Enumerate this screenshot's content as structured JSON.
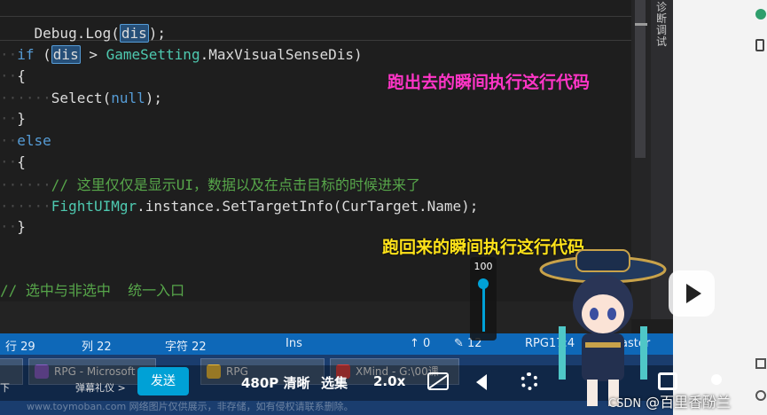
{
  "editor": {
    "lines": {
      "l1": {
        "text1": "Debug.Log(",
        "hl": "dis",
        "text2": ");"
      },
      "l2": {
        "kw": "if",
        "open": " (",
        "hl": "dis",
        "op": " > ",
        "type": "GameSetting",
        "rest": ".MaxVisualSenseDis)"
      },
      "l3": "{",
      "l4": {
        "call": "Select(",
        "kw": "null",
        "rest": ");"
      },
      "l5": "}",
      "l6": "else",
      "l7": "{",
      "l8": "// 这里仅仅是显示UI，数据以及在点击目标的时候进来了",
      "l9": {
        "type": "FightUIMgr",
        "rest": ".instance.SetTargetInfo(CurTarget.Name);"
      },
      "l10": "}",
      "l11": "// 选中与非选中  统一入口"
    }
  },
  "annotations": {
    "run_out": "跑出去的瞬间执行这行代码",
    "run_back": "跑回来的瞬间执行这行代码"
  },
  "right_panel": {
    "label1": "诊",
    "label2": "断",
    "label3": "调",
    "label4": "试"
  },
  "statusbar": {
    "row": "行 29",
    "col": "列 22",
    "char": "字符 22",
    "ins": "Ins",
    "up": "↑ 0",
    "edit": "✎ 12",
    "project": "RPG17:4",
    "master": "aster"
  },
  "taskbar": {
    "items": [
      {
        "label": "RPG - Microsoft"
      },
      {
        "label": "RPG"
      },
      {
        "label": "XMind - G:\\00课"
      }
    ],
    "left_text": "下"
  },
  "player": {
    "danmu": "弹幕礼仪 >",
    "send": "发送",
    "quality": "480P 清晰",
    "episodes": "选集",
    "speed": "2.0x",
    "volume": 100
  },
  "overlay": {
    "csdn_prefix": "CSDN",
    "csdn_name": "@百里香酚兰",
    "watermark": "www.toymoban.com 网络图片仅供展示，非存储，如有侵权请联系删除。"
  },
  "colors": {
    "keyword": "#569cd6",
    "type": "#4ec9b0",
    "comment": "#57a64a",
    "annotation_pink": "#ff35c7",
    "annotation_yellow": "#ffe31a",
    "statusbar": "#0e68b8",
    "send": "#00a1d6"
  }
}
